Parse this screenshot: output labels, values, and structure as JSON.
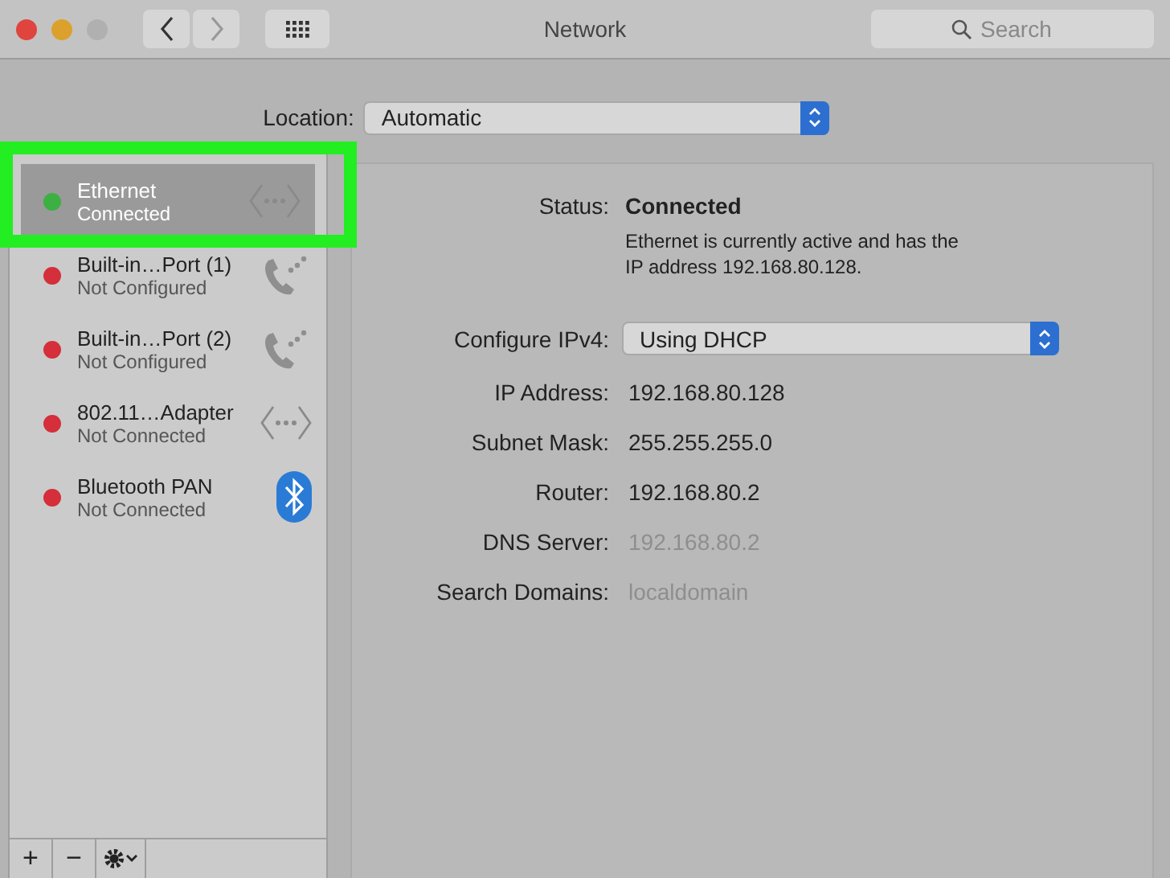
{
  "window": {
    "title": "Network"
  },
  "search": {
    "placeholder": "Search"
  },
  "location": {
    "label": "Location:",
    "value": "Automatic"
  },
  "services": [
    {
      "name": "Ethernet",
      "status": "Connected",
      "color": "#3cb043",
      "kind": "dots",
      "selected": true,
      "highlighted": true
    },
    {
      "name": "Built-in…Port (1)",
      "status": "Not Configured",
      "color": "#d42f3a",
      "kind": "phone",
      "selected": false,
      "highlighted": false
    },
    {
      "name": "Built-in…Port (2)",
      "status": "Not Configured",
      "color": "#d42f3a",
      "kind": "phone",
      "selected": false,
      "highlighted": false
    },
    {
      "name": "802.11…Adapter",
      "status": "Not Connected",
      "color": "#d42f3a",
      "kind": "dots",
      "selected": false,
      "highlighted": false
    },
    {
      "name": "Bluetooth PAN",
      "status": "Not Connected",
      "color": "#d42f3a",
      "kind": "bluetooth",
      "selected": false,
      "highlighted": false
    }
  ],
  "sidebar_buttons": [
    "+",
    "−"
  ],
  "detail": {
    "status_label": "Status:",
    "status_value": "Connected",
    "status_note": "Ethernet is currently active and has the IP address 192.168.80.128.",
    "configure": {
      "label": "Configure IPv4:",
      "value": "Using DHCP"
    },
    "fields": [
      {
        "label": "IP Address:",
        "value": "192.168.80.128",
        "dimmed": false
      },
      {
        "label": "Subnet Mask:",
        "value": "255.255.255.0",
        "dimmed": false
      },
      {
        "label": "Router:",
        "value": "192.168.80.2",
        "dimmed": false
      },
      {
        "label": "DNS Server:",
        "value": "192.168.80.2",
        "dimmed": true
      },
      {
        "label": "Search Domains:",
        "value": "localdomain",
        "dimmed": true
      }
    ]
  }
}
